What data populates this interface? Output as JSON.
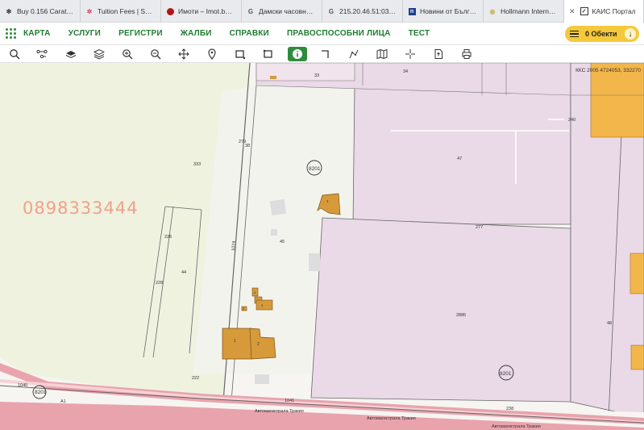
{
  "tabs": [
    {
      "label": "Buy 0.156 Carat…",
      "icon": "flower-icon"
    },
    {
      "label": "Tuition Fees | S…",
      "icon": "star-icon"
    },
    {
      "label": "Имоти – Imot.b…",
      "icon": "red-dot-icon"
    },
    {
      "label": "Дамски часовн…",
      "icon": "g-icon"
    },
    {
      "label": "215.20.46.51:03…",
      "icon": "g-icon"
    },
    {
      "label": "Новини от Бълг…",
      "icon": "news-icon"
    },
    {
      "label": "Hollmann Intern…",
      "icon": "globe-icon"
    },
    {
      "label": "КАИС Портал",
      "icon": "kais-icon",
      "active": true
    }
  ],
  "nav": {
    "items": [
      "КАРТА",
      "УСЛУГИ",
      "РЕГИСТРИ",
      "ЖАЛБИ",
      "СПРАВКИ",
      "ПРАВОСПОСОБНИ ЛИЦА",
      "ТЕСТ"
    ],
    "objects_label": "0 Обекти"
  },
  "toolbar": {
    "tools": [
      "search-icon",
      "route-icon",
      "layers-icon",
      "stack-icon",
      "zoom-in-icon",
      "zoom-out-icon",
      "move-icon",
      "pin-icon",
      "select-rect-icon",
      "select-rect-alt-icon",
      "info-icon",
      "polyline-icon",
      "measure-icon",
      "map-icon",
      "crosshair-icon",
      "document-icon",
      "print-icon"
    ],
    "active_tool": "info-icon"
  },
  "map": {
    "coords": "ККС 2005 4724053, 332270",
    "phone_watermark": "0898333444",
    "labels": {
      "p333": "333",
      "p279": "279",
      "p38": "38",
      "p1074": "1074",
      "p8201a": "8201",
      "p8201b": "8201",
      "p8201c": "8201",
      "p45": "45",
      "p47": "47",
      "p277": "277",
      "p2885": "2885",
      "p226": "226",
      "p44": "44",
      "p228": "228",
      "p222": "222",
      "p1040": "1040",
      "p1041": "1041",
      "p238": "238",
      "p48": "48",
      "p240": "240",
      "p33": "33",
      "p34": "34",
      "road_a1": "А1",
      "road_1": "Автомагистрала Тракия",
      "road_2": "Автомагистрала Тракия",
      "road_3": "Автомагистрала Тракия",
      "b1": "1",
      "b2": "2",
      "b3": "3",
      "b4": "4",
      "b5": "1",
      "b6": "2"
    }
  },
  "colors": {
    "brand_green": "#1e7d30",
    "accent_yellow": "#f5c93a",
    "parcel_green": "#eef2df",
    "parcel_pink": "#ead9e7",
    "building": "#d69a3a",
    "road_pink": "#e9a3ad"
  }
}
